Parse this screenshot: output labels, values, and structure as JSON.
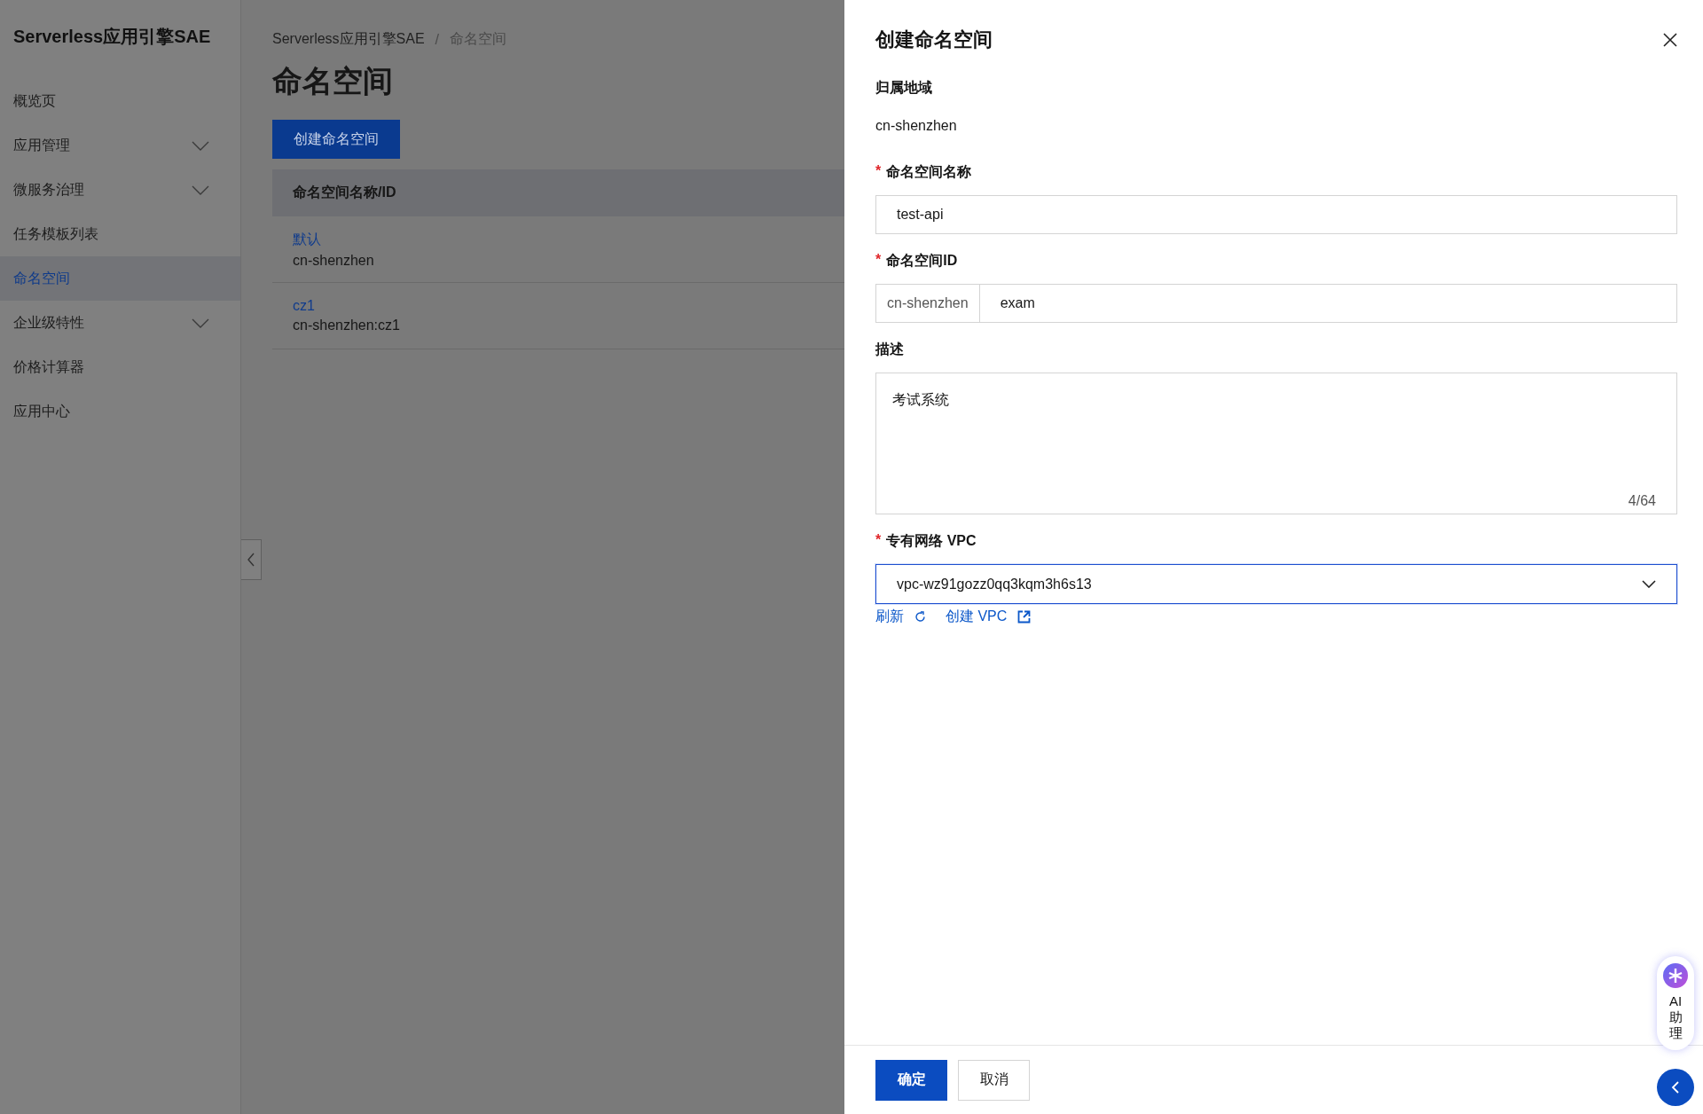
{
  "sidebar": {
    "title": "Serverless应用引擎SAE",
    "items": [
      {
        "label": "概览页",
        "selected": false,
        "expandable": false
      },
      {
        "label": "应用管理",
        "selected": false,
        "expandable": true
      },
      {
        "label": "微服务治理",
        "selected": false,
        "expandable": true
      },
      {
        "label": "任务模板列表",
        "selected": false,
        "expandable": false
      },
      {
        "label": "命名空间",
        "selected": true,
        "expandable": false
      },
      {
        "label": "企业级特性",
        "selected": false,
        "expandable": true
      },
      {
        "label": "价格计算器",
        "selected": false,
        "expandable": false
      },
      {
        "label": "应用中心",
        "selected": false,
        "expandable": false
      }
    ]
  },
  "breadcrumb": [
    {
      "label": "Serverless应用引擎SAE",
      "current": false
    },
    {
      "label": "命名空间",
      "current": true
    }
  ],
  "breadcrumb_separator": "/",
  "page_title": "命名空间",
  "create_button": "创建命名空间",
  "table": {
    "columns": [
      "命名空间名称/ID"
    ],
    "rows": [
      {
        "name": "默认",
        "id": "cn-shenzhen"
      },
      {
        "name": "cz1",
        "id": "cn-shenzhen:cz1"
      }
    ]
  },
  "drawer": {
    "title": "创建命名空间",
    "required_mark": "*",
    "fields": [
      {
        "kind": "static",
        "label": "归属地域",
        "required": false,
        "value": "cn-shenzhen"
      },
      {
        "kind": "input",
        "label": "命名空间名称",
        "required": true,
        "value": "test-api"
      },
      {
        "kind": "prefixed_input",
        "label": "命名空间ID",
        "required": true,
        "prefix": "cn-shenzhen",
        "value": "exam"
      },
      {
        "kind": "textarea",
        "label": "描述",
        "required": false,
        "value": "考试系统",
        "counter": "4/64"
      },
      {
        "kind": "select",
        "label": "专有网络 VPC",
        "required": true,
        "value": "vpc-wz91gozz0qq3kqm3h6s13",
        "focused": true
      }
    ],
    "links": [
      {
        "label": "刷新",
        "kind": "refresh"
      },
      {
        "label": "创建 VPC",
        "kind": "external"
      }
    ],
    "buttons": [
      {
        "label": "确定",
        "primary": true
      },
      {
        "label": "取消",
        "primary": false
      }
    ]
  },
  "ai_assistant": {
    "label": "AI助理"
  }
}
